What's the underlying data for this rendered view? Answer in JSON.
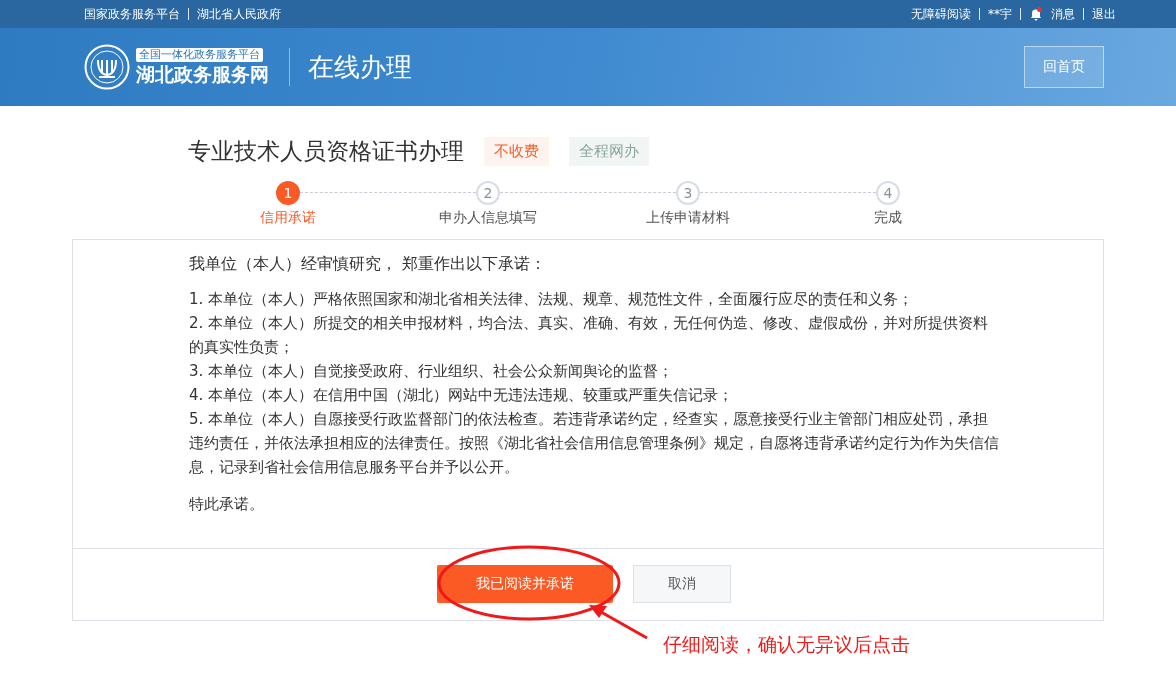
{
  "top_bar": {
    "left_links": [
      "国家政务服务平台",
      "湖北省人民政府"
    ],
    "accessibility": "无障碍阅读",
    "user": "**宇",
    "messages": {
      "label": "消息",
      "unread": true
    },
    "logout": "退出"
  },
  "header": {
    "logo_badge": "全国一体化政务服务平台",
    "logo_title": "湖北政务服务网",
    "section": "在线办理",
    "home_button": "回首页"
  },
  "service": {
    "title": "专业技术人员资格证书办理",
    "tags": [
      {
        "label": "不收费",
        "kind": "fee"
      },
      {
        "label": "全程网办",
        "kind": "online"
      }
    ]
  },
  "steps": [
    {
      "number": "1",
      "label": "信用承诺",
      "active": true
    },
    {
      "number": "2",
      "label": "申办人信息填写",
      "active": false
    },
    {
      "number": "3",
      "label": "上传申请材料",
      "active": false
    },
    {
      "number": "4",
      "label": "完成",
      "active": false
    }
  ],
  "pledge": {
    "heading": "我单位（本人）经审慎研究， 郑重作出以下承诺：",
    "items": [
      "1. 本单位（本人）严格依照国家和湖北省相关法律、法规、规章、规范性文件，全面履行应尽的责任和义务；",
      "2. 本单位（本人）所提交的相关申报材料，均合法、真实、准确、有效，无任何伪造、修改、虚假成份，并对所提供资料的真实性负责；",
      "3. 本单位（本人）自觉接受政府、行业组织、社会公众新闻舆论的监督；",
      "4. 本单位（本人）在信用中国（湖北）网站中无违法违规、较重或严重失信记录；",
      "5. 本单位（本人）自愿接受行政监督部门的依法检查。若违背承诺约定，经查实，愿意接受行业主管部门相应处罚，承担违约责任，并依法承担相应的法律责任。按照《湖北省社会信用信息管理条例》规定，自愿将违背承诺约定行为作为失信信息，记录到省社会信用信息服务平台并予以公开。"
    ],
    "closing": "特此承诺。"
  },
  "buttons": {
    "confirm": "我已阅读并承诺",
    "cancel": "取消"
  },
  "annotation": {
    "text": "仔细阅读，确认无异议后点击"
  }
}
